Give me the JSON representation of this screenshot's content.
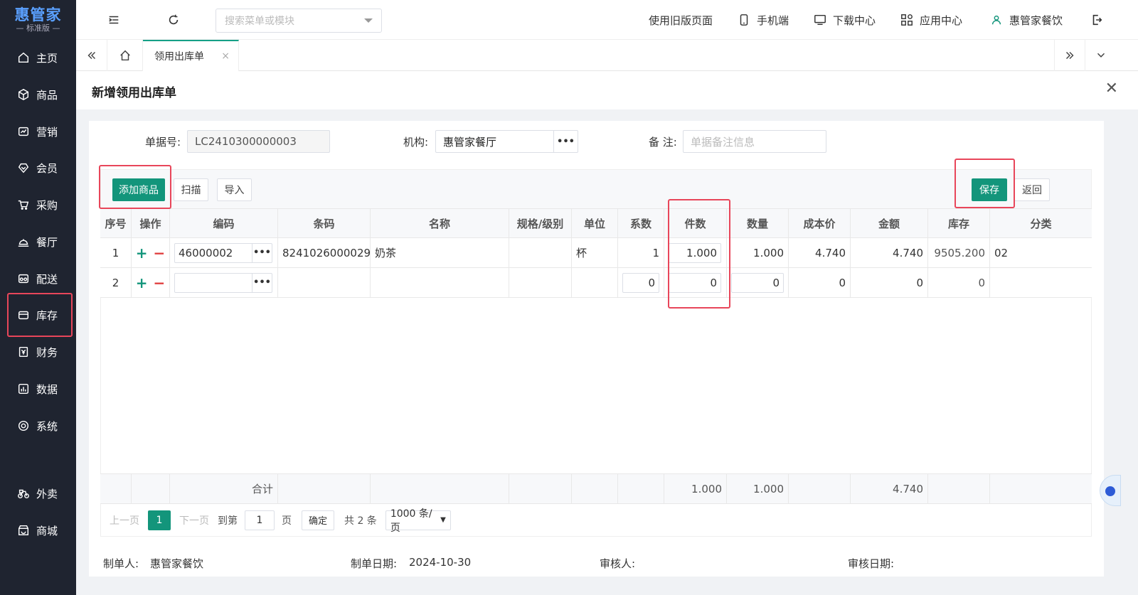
{
  "app": {
    "logo_title": "惠管家",
    "logo_sub": "— 标准版 —"
  },
  "sidebar": {
    "items": [
      {
        "label": "主页",
        "icon": "home-icon"
      },
      {
        "label": "商品",
        "icon": "box-icon"
      },
      {
        "label": "营销",
        "icon": "chart-icon"
      },
      {
        "label": "会员",
        "icon": "member-icon"
      },
      {
        "label": "采购",
        "icon": "cart-icon"
      },
      {
        "label": "餐厅",
        "icon": "dish-icon"
      },
      {
        "label": "配送",
        "icon": "truck-icon"
      },
      {
        "label": "库存",
        "icon": "inventory-icon"
      },
      {
        "label": "财务",
        "icon": "finance-icon"
      },
      {
        "label": "数据",
        "icon": "data-icon"
      },
      {
        "label": "系统",
        "icon": "settings-icon"
      },
      {
        "label": "外卖",
        "icon": "bike-icon"
      },
      {
        "label": "商城",
        "icon": "store-icon"
      }
    ],
    "active": "库存"
  },
  "topbar": {
    "search_placeholder": "搜索菜单或模块",
    "old_version": "使用旧版页面",
    "mobile": "手机端",
    "download": "下载中心",
    "apps": "应用中心",
    "user": "惠管家餐饮"
  },
  "tabs": {
    "active_tab": "领用出库单",
    "close": "×"
  },
  "page": {
    "title": "新增领用出库单",
    "close": "✕"
  },
  "form": {
    "doc_no_label": "单据号:",
    "doc_no_value": "LC2410300000003",
    "org_label": "机构:",
    "org_value": "惠管家餐厅",
    "note_label": "备 注:",
    "note_placeholder": "单据备注信息",
    "dots": "•••"
  },
  "toolbar": {
    "add": "添加商品",
    "scan": "扫描",
    "import": "导入",
    "save": "保存",
    "back": "返回"
  },
  "table": {
    "headers": [
      "序号",
      "操作",
      "编码",
      "条码",
      "名称",
      "规格/级别",
      "单位",
      "系数",
      "件数",
      "数量",
      "成本价",
      "金额",
      "库存",
      "分类"
    ],
    "rows": [
      {
        "no": "1",
        "code": "46000002",
        "barcode": "8241026000029",
        "name": "奶茶",
        "spec": "",
        "unit": "杯",
        "factor": "1",
        "pieces": "1.000",
        "qty": "1.000",
        "cost": "4.740",
        "amount": "4.740",
        "stock": "9505.200",
        "category": "02"
      },
      {
        "no": "2",
        "code": "",
        "barcode": "",
        "name": "",
        "spec": "",
        "unit": "",
        "factor": "0",
        "pieces": "0",
        "qty": "0",
        "cost": "0",
        "amount": "0",
        "stock": "0",
        "category": ""
      }
    ],
    "sum": {
      "label": "合计",
      "pieces": "1.000",
      "qty": "1.000",
      "amount": "4.740"
    }
  },
  "pager": {
    "prev": "上一页",
    "current": "1",
    "next": "下一页",
    "goto": "到第",
    "goto_value": "1",
    "page_unit": "页",
    "confirm": "确定",
    "total": "共 2 条",
    "page_size": "1000 条/页"
  },
  "footer": {
    "maker_label": "制单人:",
    "maker": "惠管家餐饮",
    "date_label": "制单日期:",
    "date": "2024-10-30",
    "auditor_label": "审核人:",
    "audit_date_label": "审核日期:"
  }
}
